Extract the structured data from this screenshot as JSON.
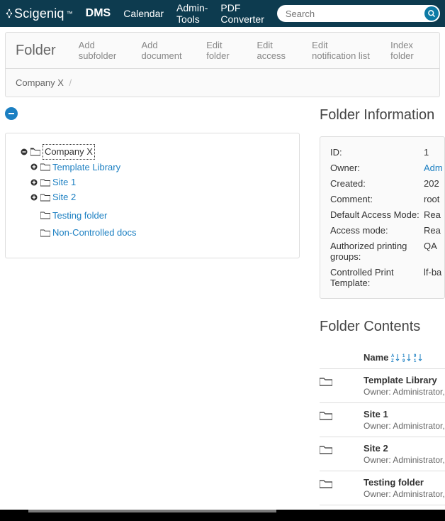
{
  "nav": {
    "brand": "Scigeniq",
    "items": [
      "DMS",
      "Calendar",
      "Admin-Tools",
      "PDF Converter"
    ],
    "search_placeholder": "Search"
  },
  "toolbar": {
    "title": "Folder",
    "actions": [
      "Add subfolder",
      "Add document",
      "Edit folder",
      "Edit access",
      "Edit notification list",
      "Index folder"
    ]
  },
  "breadcrumb": {
    "item0": "Company X"
  },
  "tree": {
    "root": "Company X",
    "children": [
      {
        "label": "Template Library",
        "expandable": true
      },
      {
        "label": "Site 1",
        "expandable": true
      },
      {
        "label": "Site 2",
        "expandable": true
      },
      {
        "label": "Testing folder",
        "expandable": false
      },
      {
        "label": "Non-Controlled docs",
        "expandable": false
      }
    ]
  },
  "folder_info": {
    "title": "Folder Information",
    "rows": {
      "id_label": "ID:",
      "id_value": "1",
      "owner_label": "Owner:",
      "owner_value": "Adm",
      "created_label": "Created:",
      "created_value": "202",
      "comment_label": "Comment:",
      "comment_value": "root",
      "dam_label": "Default Access Mode:",
      "dam_value": "Rea",
      "am_label": "Access mode:",
      "am_value": "Rea",
      "apg_label": "Authorized printing groups:",
      "apg_value": "QA",
      "cpt_label": "Controlled Print Template:",
      "cpt_value": "lf-ba"
    }
  },
  "contents": {
    "title": "Folder Contents",
    "name_header": "Name",
    "items": [
      {
        "title": "Template Library",
        "sub": "Owner: Administrator, C"
      },
      {
        "title": "Site 1",
        "sub": "Owner: Administrator, C"
      },
      {
        "title": "Site 2",
        "sub": "Owner: Administrator, C"
      },
      {
        "title": "Testing folder",
        "sub": "Owner: Administrator, C"
      }
    ]
  }
}
